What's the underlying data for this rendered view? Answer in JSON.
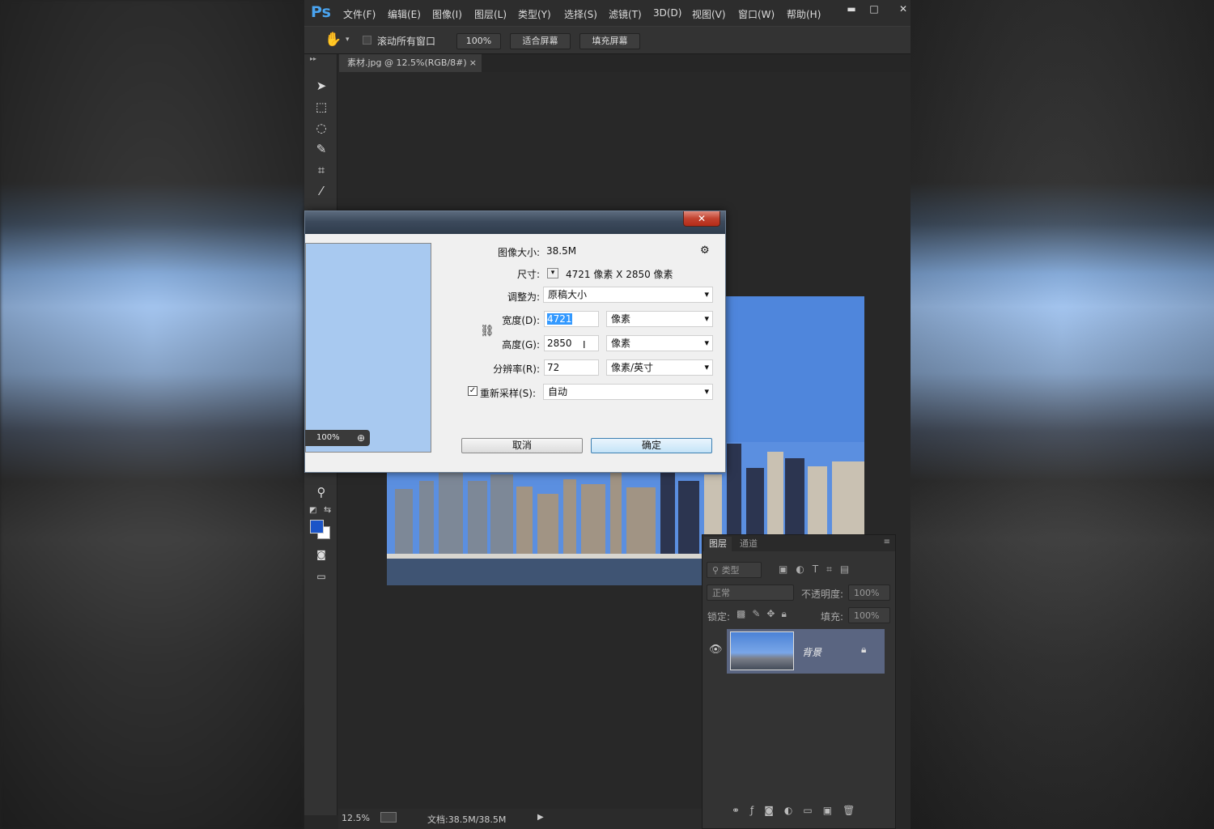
{
  "app": {
    "logo": "Ps",
    "menu": [
      "文件(F)",
      "编辑(E)",
      "图像(I)",
      "图层(L)",
      "类型(Y)",
      "选择(S)",
      "滤镜(T)",
      "3D(D)",
      "视图(V)",
      "窗口(W)",
      "帮助(H)"
    ],
    "window_controls": [
      "▬",
      "□",
      "✕"
    ]
  },
  "options_bar": {
    "scroll_all_label": "滚动所有窗口",
    "zoom_btn": "100%",
    "fit_screen_btn": "适合屏幕",
    "fill_screen_btn": "填充屏幕"
  },
  "document_tab": {
    "title": "素材.jpg @ 12.5%(RGB/8#)",
    "close": "×"
  },
  "status_bar": {
    "zoom": "12.5%",
    "doc_info": "文档:38.5M/38.5M"
  },
  "layers_panel": {
    "tabs": [
      "图层",
      "通道"
    ],
    "filter_label": "类型",
    "blend_mode": "正常",
    "opacity_label": "不透明度:",
    "opacity_value": "100%",
    "lock_label": "锁定:",
    "fill_label": "填充:",
    "fill_value": "100%",
    "layer_name": "背景"
  },
  "dialog": {
    "image_size_label": "图像大小:",
    "image_size_value": "38.5M",
    "dimensions_label": "尺寸:",
    "dimensions_value": "4721 像素  X  2850 像素",
    "fit_to_label": "调整为:",
    "fit_to_value": "原稿大小",
    "width_label": "宽度(D):",
    "width_value": "4721",
    "width_unit": "像素",
    "height_label": "高度(G):",
    "height_value": "2850",
    "height_unit": "像素",
    "resolution_label": "分辨率(R):",
    "resolution_value": "72",
    "resolution_unit": "像素/英寸",
    "resample_label": "重新采样(S):",
    "resample_value": "自动",
    "preview_zoom": "100%",
    "cancel_btn": "取消",
    "ok_btn": "确定"
  }
}
